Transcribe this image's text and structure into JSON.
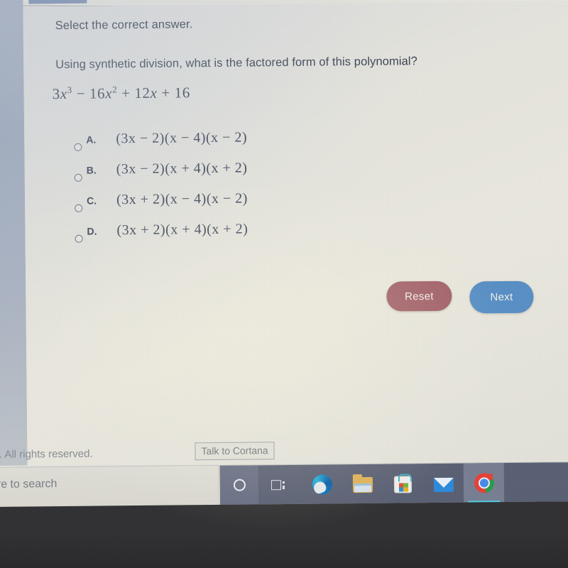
{
  "app": {
    "copyright_text": "n. All rights reserved."
  },
  "quiz": {
    "prompt": "Select the correct answer.",
    "question": "Using synthetic division, what is the factored form of this polynomial?",
    "polynomial": {
      "coefficient_cubic": "3",
      "cubic_var": "x",
      "cubic_exp": "3",
      "op1": "−",
      "coefficient_quadratic": "16",
      "quad_var": "x",
      "quad_exp": "2",
      "op2": "+",
      "coefficient_linear": "12",
      "lin_var": "x",
      "op3": "+",
      "constant": "16"
    },
    "options": [
      {
        "letter": "A.",
        "expression": "(3x − 2)(x − 4)(x − 2)",
        "selected": false
      },
      {
        "letter": "B.",
        "expression": "(3x − 2)(x + 4)(x + 2)",
        "selected": false
      },
      {
        "letter": "C.",
        "expression": "(3x + 2)(x − 4)(x − 2)",
        "selected": false
      },
      {
        "letter": "D.",
        "expression": "(3x + 2)(x + 4)(x + 2)",
        "selected": false
      }
    ],
    "buttons": {
      "reset_label": "Reset",
      "next_label": "Next",
      "reset_color": "#a5636b",
      "next_color": "#5b93c9"
    }
  },
  "taskbar": {
    "search_text": "ere to search",
    "search_placeholder": "Type here to search",
    "cortana_tooltip": "Talk to Cortana",
    "cortana_icon": "cortana-circle-icon",
    "taskview_icon": "task-view-icon",
    "apps": [
      {
        "name": "edge",
        "icon": "microsoft-edge-icon",
        "active": false
      },
      {
        "name": "explorer",
        "icon": "file-explorer-icon",
        "active": false
      },
      {
        "name": "store",
        "icon": "microsoft-store-icon",
        "active": false
      },
      {
        "name": "mail",
        "icon": "mail-icon",
        "active": false
      },
      {
        "name": "chrome",
        "icon": "google-chrome-icon",
        "active": true
      }
    ]
  }
}
